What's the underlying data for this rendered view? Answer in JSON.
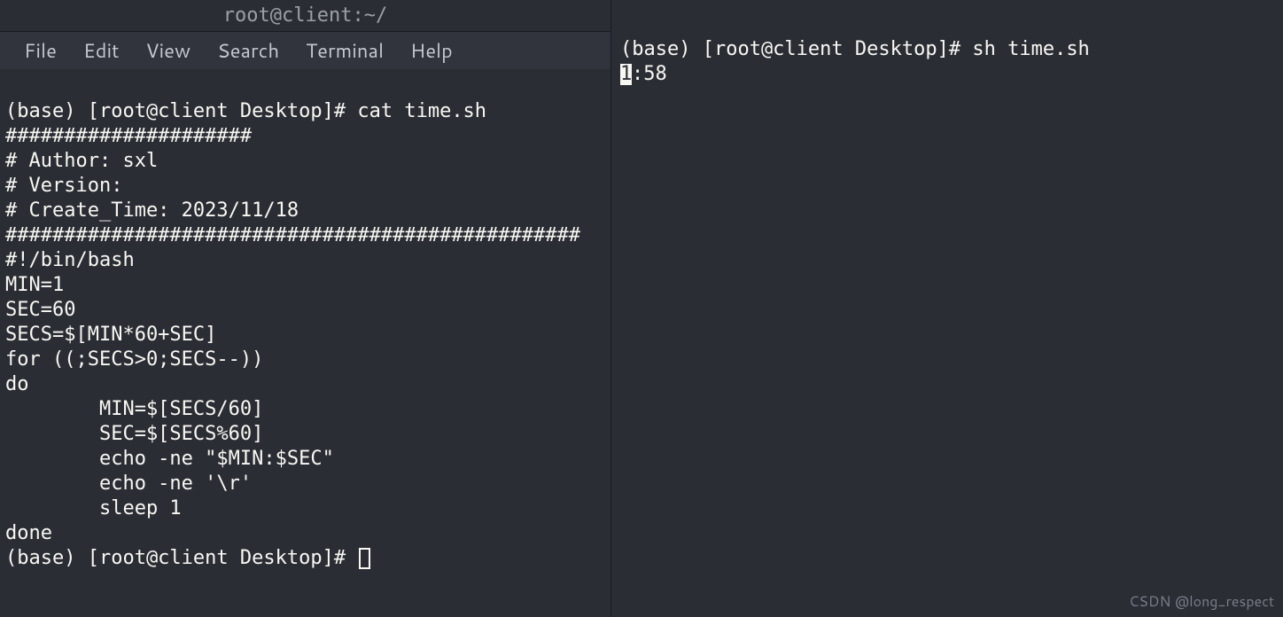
{
  "left_window": {
    "title": "root@client:~/",
    "menu": {
      "file": "File",
      "edit": "Edit",
      "view": "View",
      "search": "Search",
      "terminal": "Terminal",
      "help": "Help"
    },
    "prompt1": "(base) [root@client Desktop]# cat time.sh",
    "script_lines": [
      "#####################",
      "# Author: sxl",
      "# Version:",
      "# Create_Time: 2023/11/18",
      "#################################################",
      "#!/bin/bash",
      "MIN=1",
      "SEC=60",
      "SECS=$[MIN*60+SEC]",
      "for ((;SECS>0;SECS--))",
      "do",
      "        MIN=$[SECS/60]",
      "        SEC=$[SECS%60]",
      "        echo -ne \"$MIN:$SEC\"",
      "        echo -ne '\\r'",
      "        sleep 1",
      "done"
    ],
    "prompt2": "(base) [root@client Desktop]# "
  },
  "right_window": {
    "prompt": "(base) [root@client Desktop]# sh time.sh",
    "cursor_char": "1",
    "output_after_cursor": ":58"
  },
  "watermark": "CSDN @long_respect"
}
